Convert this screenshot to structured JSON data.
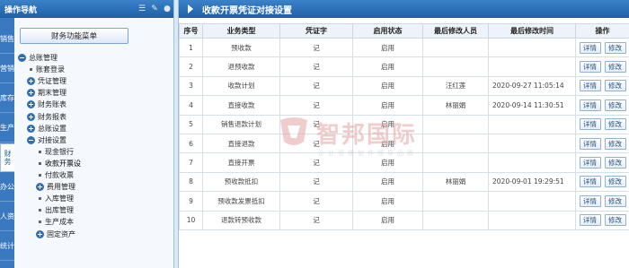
{
  "nav": {
    "title": "操作导航",
    "vtabs": [
      "销售",
      "营销",
      "库存",
      "生产",
      "财务",
      "办公",
      "人资",
      "统计"
    ],
    "active_vtab": "财务",
    "menu_button": "财务功能菜单",
    "tree": [
      {
        "label": "总账管理",
        "kind": "minus",
        "indent": 0
      },
      {
        "label": "账套登录",
        "kind": "bullet",
        "indent": 1
      },
      {
        "label": "凭证管理",
        "kind": "plus",
        "indent": 1
      },
      {
        "label": "期末管理",
        "kind": "plus",
        "indent": 1
      },
      {
        "label": "财务账表",
        "kind": "plus",
        "indent": 1
      },
      {
        "label": "财务报表",
        "kind": "plus",
        "indent": 1
      },
      {
        "label": "总账设置",
        "kind": "plus",
        "indent": 1
      },
      {
        "label": "对接设置",
        "kind": "minus",
        "indent": 1
      },
      {
        "label": "现金银行",
        "kind": "bullet",
        "indent": 2
      },
      {
        "label": "收款开票设",
        "kind": "bullet",
        "indent": 2
      },
      {
        "label": "付款收票",
        "kind": "bullet",
        "indent": 2
      },
      {
        "label": "费用管理",
        "kind": "plus",
        "indent": 2
      },
      {
        "label": "入库管理",
        "kind": "bullet",
        "indent": 2
      },
      {
        "label": "出库管理",
        "kind": "bullet",
        "indent": 2
      },
      {
        "label": "生产成本",
        "kind": "bullet",
        "indent": 2
      },
      {
        "label": "固定资产",
        "kind": "plus",
        "indent": 2
      }
    ],
    "selected_tree_item": "收款开票设"
  },
  "main": {
    "title": "收款开票凭证对接设置",
    "columns": [
      "序号",
      "业务类型",
      "凭证字",
      "启用状态",
      "最后修改人员",
      "最后修改时间",
      "操作"
    ],
    "rows": [
      {
        "no": "1",
        "type": "预收款",
        "voucher": "记",
        "status": "启用",
        "modifier": "",
        "time": ""
      },
      {
        "no": "2",
        "type": "退预收款",
        "voucher": "记",
        "status": "启用",
        "modifier": "",
        "time": ""
      },
      {
        "no": "3",
        "type": "收款计划",
        "voucher": "记",
        "status": "启用",
        "modifier": "汪红莲",
        "time": "2020-09-27 11:05:14"
      },
      {
        "no": "4",
        "type": "直接收款",
        "voucher": "记",
        "status": "启用",
        "modifier": "林丽娟",
        "time": "2020-09-14 11:30:51"
      },
      {
        "no": "5",
        "type": "销售退款计划",
        "voucher": "记",
        "status": "启用",
        "modifier": "",
        "time": ""
      },
      {
        "no": "6",
        "type": "直接退款",
        "voucher": "记",
        "status": "启用",
        "modifier": "",
        "time": ""
      },
      {
        "no": "7",
        "type": "直接开票",
        "voucher": "记",
        "status": "启用",
        "modifier": "",
        "time": ""
      },
      {
        "no": "8",
        "type": "预收款抵扣",
        "voucher": "记",
        "status": "启用",
        "modifier": "林丽娟",
        "time": "2020-09-01 19:29:51"
      },
      {
        "no": "9",
        "type": "预收款发票抵扣",
        "voucher": "记",
        "status": "启用",
        "modifier": "",
        "time": ""
      },
      {
        "no": "10",
        "type": "退款转预收款",
        "voucher": "记",
        "status": "启用",
        "modifier": "",
        "time": ""
      }
    ],
    "detail_label": "详情",
    "edit_label": "修改"
  },
  "watermark": {
    "name": "智邦国际",
    "sub": "企业管理软件领导品牌"
  },
  "colors": {
    "header_blue": "#1f5fa6",
    "vtab_blue": "#3a78bf",
    "watermark_red": "#e6a3a3"
  }
}
